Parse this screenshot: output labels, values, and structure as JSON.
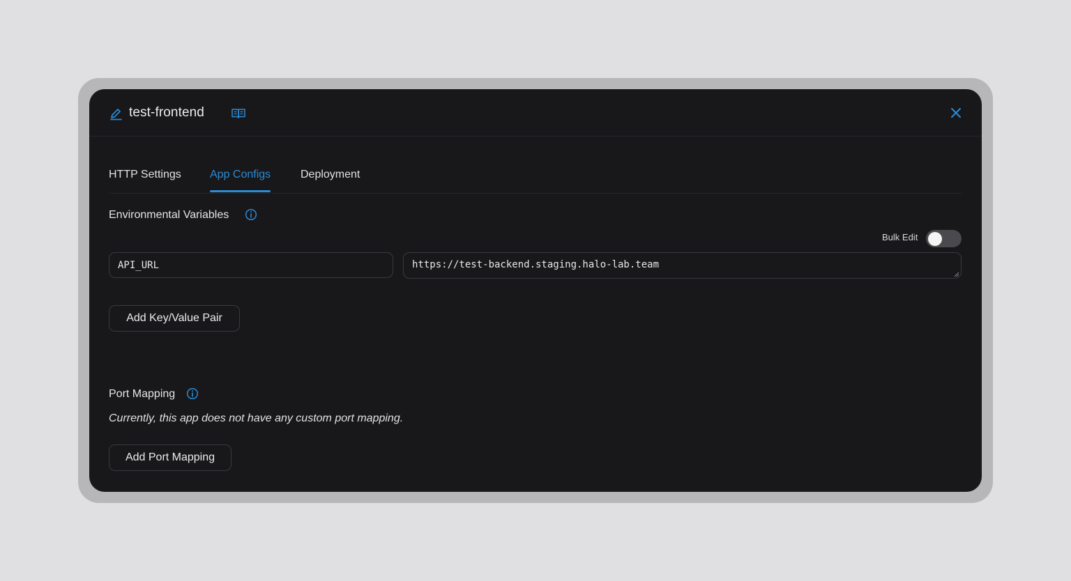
{
  "header": {
    "title": "test-frontend",
    "edit_icon": "pencil-icon",
    "docs_icon": "book-open-icon",
    "close_icon": "close-icon"
  },
  "tabs": [
    {
      "label": "HTTP Settings",
      "active": false
    },
    {
      "label": "App Configs",
      "active": true
    },
    {
      "label": "Deployment",
      "active": false
    }
  ],
  "env_vars": {
    "label": "Environmental Variables",
    "info_icon": "info-icon",
    "bulk_edit_label": "Bulk Edit",
    "bulk_edit_on": false,
    "pairs": [
      {
        "key": "API_URL",
        "value": "https://test-backend.staging.halo-lab.team"
      }
    ],
    "add_button_label": "Add Key/Value Pair"
  },
  "port_mapping": {
    "label": "Port Mapping",
    "info_icon": "info-icon",
    "empty_text": "Currently, this app does not have any custom port mapping.",
    "add_button_label": "Add Port Mapping"
  },
  "colors": {
    "accent": "#2a8bd6",
    "modal_bg": "#18181b",
    "page_bg": "#e0dfe1"
  }
}
